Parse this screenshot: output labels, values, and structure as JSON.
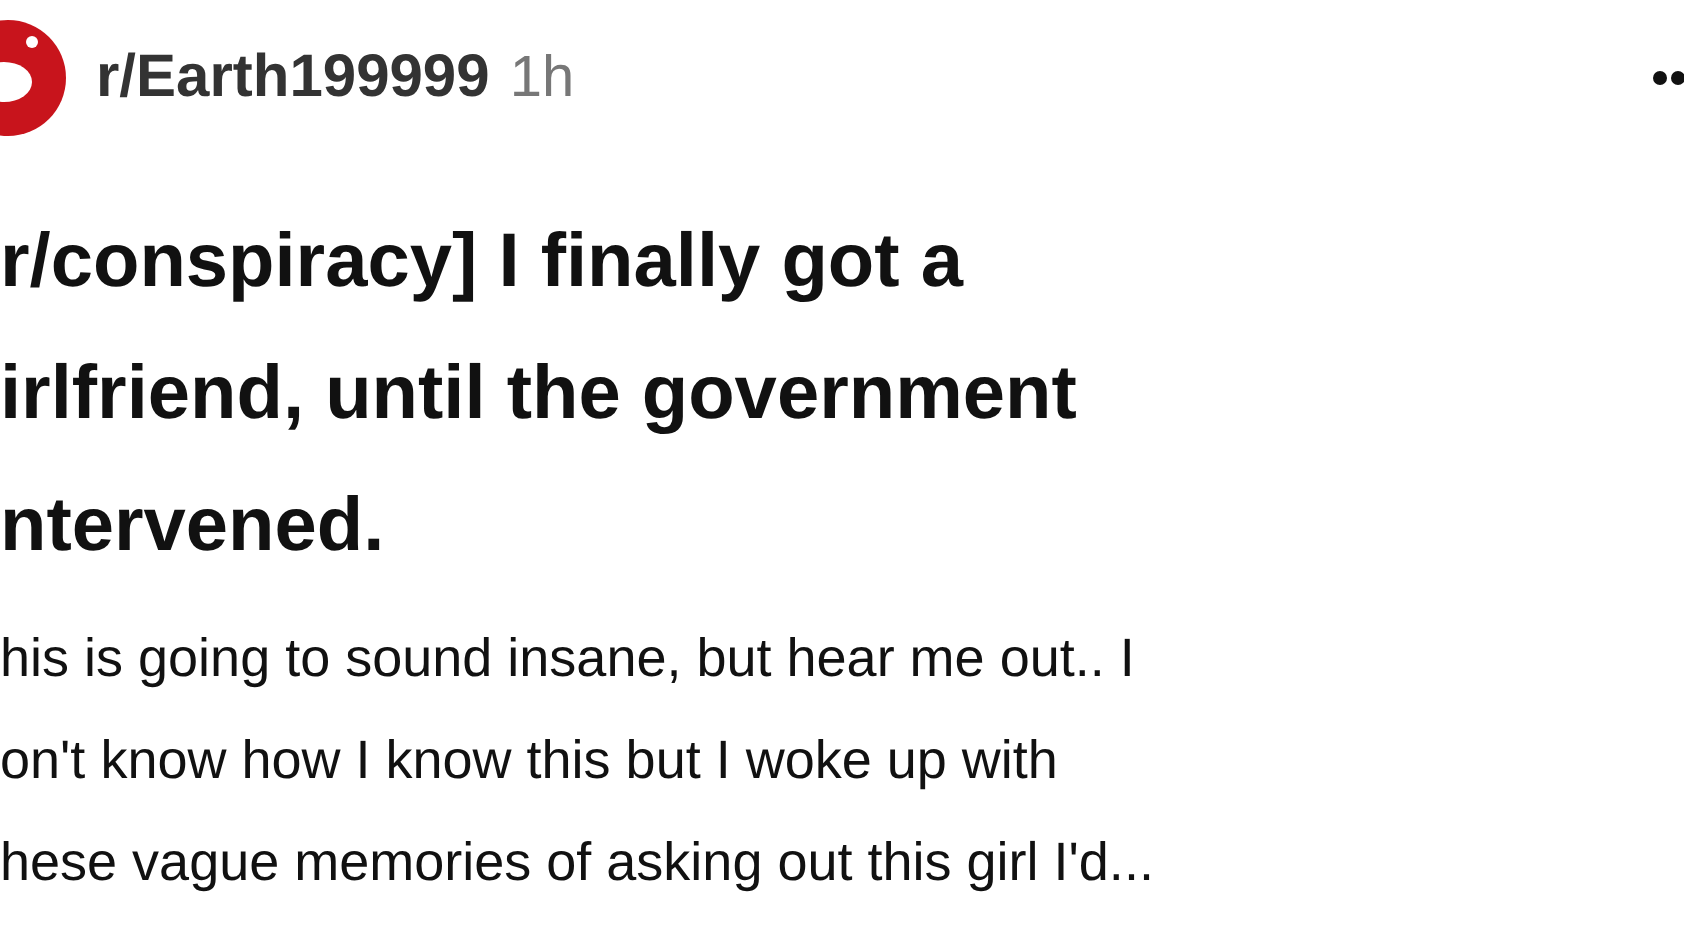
{
  "post": {
    "community": "r/Earth199999",
    "age": "1h",
    "title_lines": [
      "r/conspiracy] I finally got a",
      "irlfriend, until the government",
      "ntervened."
    ],
    "body_lines": [
      "his is going to sound insane, but hear me out.. I",
      "on't know how I know this but I woke up with",
      "hese vague memories of asking out this girl I'd..."
    ]
  }
}
